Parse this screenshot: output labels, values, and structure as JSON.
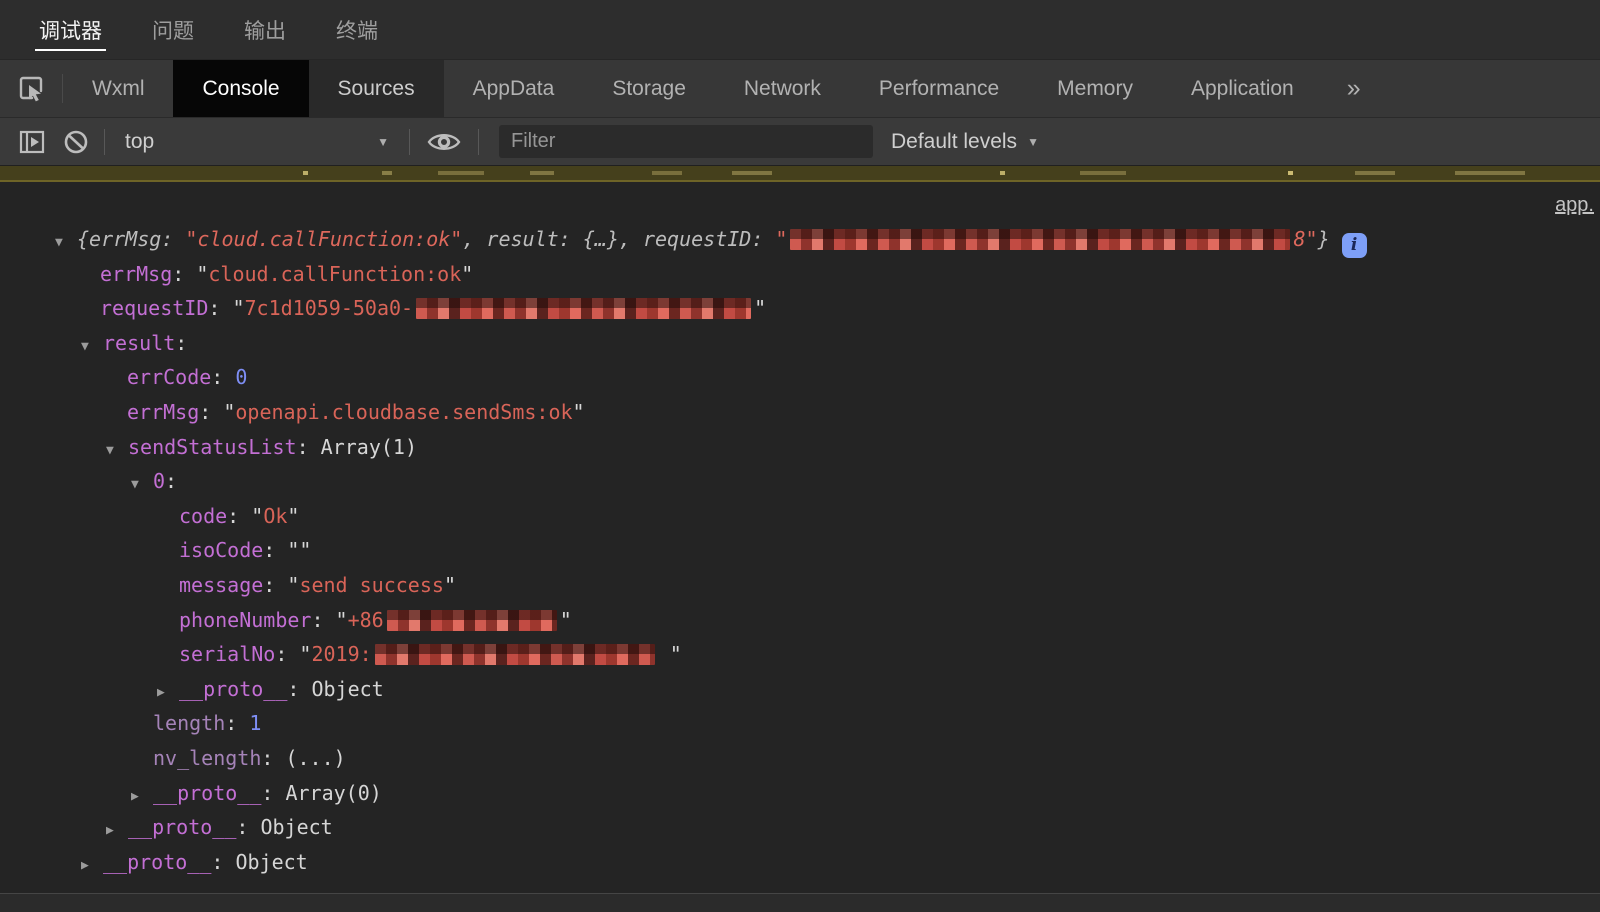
{
  "window": {
    "tabs": [
      {
        "label": "调试器",
        "active": true
      },
      {
        "label": "问题",
        "active": false
      },
      {
        "label": "输出",
        "active": false
      },
      {
        "label": "终端",
        "active": false
      }
    ]
  },
  "devtools": {
    "tabs": [
      {
        "label": "Wxml",
        "state": "normal"
      },
      {
        "label": "Console",
        "state": "active"
      },
      {
        "label": "Sources",
        "state": "highlight"
      },
      {
        "label": "AppData",
        "state": "normal"
      },
      {
        "label": "Storage",
        "state": "normal"
      },
      {
        "label": "Network",
        "state": "normal"
      },
      {
        "label": "Performance",
        "state": "normal"
      },
      {
        "label": "Memory",
        "state": "normal"
      },
      {
        "label": "Application",
        "state": "normal"
      }
    ],
    "overflow_chevron": "»"
  },
  "toolbar": {
    "context_selector": "top",
    "filter_placeholder": "Filter",
    "levels_dropdown": "Default levels",
    "dropdown_arrow": "▼"
  },
  "icons": {
    "inspect": "inspect-element-icon",
    "sidebar_toggle": "show-console-sidebar-icon",
    "clear": "clear-console-icon",
    "eye": "live-expression-icon",
    "info": "i"
  },
  "colors": {
    "property_key": "#c36fd4",
    "property_key_dim": "#a583b8",
    "string_value": "#d96458",
    "number_value": "#7e8ef5",
    "plain_value": "#d6d6d6",
    "preview_text": "#bdbdbd",
    "info_badge_bg": "#7e9ff7",
    "warning_row_bg": "#45401c",
    "console_bg": "#242424"
  },
  "console": {
    "source_link": "app.",
    "rows": [
      {
        "pad": 55,
        "arrow": "down",
        "italic": true,
        "segs": [
          [
            "gi",
            "{errMsg: "
          ],
          [
            "si",
            "\"cloud.callFunction:ok\""
          ],
          [
            "gi",
            ", result: "
          ],
          [
            "gi",
            "{…}"
          ],
          [
            "gi",
            ", requestID: "
          ],
          [
            "si",
            "\""
          ],
          [
            "R",
            500
          ],
          [
            "si",
            "8\""
          ],
          [
            "gi",
            "}"
          ],
          [
            "IC",
            "i"
          ]
        ]
      },
      {
        "pad": 100,
        "arrow": null,
        "segs": [
          [
            "k",
            "errMsg"
          ],
          [
            "p",
            ": "
          ],
          [
            "q",
            "\""
          ],
          [
            "s",
            "cloud.callFunction:ok"
          ],
          [
            "q",
            "\""
          ]
        ]
      },
      {
        "pad": 100,
        "arrow": null,
        "segs": [
          [
            "k",
            "requestID"
          ],
          [
            "p",
            ": "
          ],
          [
            "q",
            "\""
          ],
          [
            "s",
            "7c1d1059-50a0-"
          ],
          [
            "R",
            335
          ],
          [
            "q",
            "\""
          ]
        ]
      },
      {
        "pad": 81,
        "arrow": "down",
        "segs": [
          [
            "k",
            "result"
          ],
          [
            "p",
            ":"
          ]
        ]
      },
      {
        "pad": 127,
        "arrow": null,
        "segs": [
          [
            "k",
            "errCode"
          ],
          [
            "p",
            ": "
          ],
          [
            "n",
            "0"
          ]
        ]
      },
      {
        "pad": 127,
        "arrow": null,
        "segs": [
          [
            "k",
            "errMsg"
          ],
          [
            "p",
            ": "
          ],
          [
            "q",
            "\""
          ],
          [
            "s",
            "openapi.cloudbase.sendSms:ok"
          ],
          [
            "q",
            "\""
          ]
        ]
      },
      {
        "pad": 106,
        "arrow": "down",
        "segs": [
          [
            "k",
            "sendStatusList"
          ],
          [
            "p",
            ": "
          ],
          [
            "p",
            "Array(1)"
          ]
        ]
      },
      {
        "pad": 131,
        "arrow": "down",
        "segs": [
          [
            "k",
            "0"
          ],
          [
            "p",
            ":"
          ]
        ]
      },
      {
        "pad": 179,
        "arrow": null,
        "segs": [
          [
            "k",
            "code"
          ],
          [
            "p",
            ": "
          ],
          [
            "q",
            "\""
          ],
          [
            "s",
            "Ok"
          ],
          [
            "q",
            "\""
          ]
        ]
      },
      {
        "pad": 179,
        "arrow": null,
        "segs": [
          [
            "k",
            "isoCode"
          ],
          [
            "p",
            ": "
          ],
          [
            "q",
            "\"\""
          ]
        ]
      },
      {
        "pad": 179,
        "arrow": null,
        "segs": [
          [
            "k",
            "message"
          ],
          [
            "p",
            ": "
          ],
          [
            "q",
            "\""
          ],
          [
            "s",
            "send success"
          ],
          [
            "q",
            "\""
          ]
        ]
      },
      {
        "pad": 179,
        "arrow": null,
        "segs": [
          [
            "k",
            "phoneNumber"
          ],
          [
            "p",
            ": "
          ],
          [
            "q",
            "\""
          ],
          [
            "s",
            "+86"
          ],
          [
            "R",
            170
          ],
          [
            "q",
            "\""
          ]
        ]
      },
      {
        "pad": 179,
        "arrow": null,
        "segs": [
          [
            "k",
            "serialNo"
          ],
          [
            "p",
            ": "
          ],
          [
            "q",
            "\""
          ],
          [
            "s",
            "2019:"
          ],
          [
            "R",
            280
          ],
          [
            "p",
            " "
          ],
          [
            "q",
            "\""
          ]
        ]
      },
      {
        "pad": 157,
        "arrow": "right",
        "segs": [
          [
            "k",
            "__proto__"
          ],
          [
            "p",
            ": "
          ],
          [
            "p",
            "Object"
          ]
        ]
      },
      {
        "pad": 153,
        "arrow": null,
        "segs": [
          [
            "kd",
            "length"
          ],
          [
            "p",
            ": "
          ],
          [
            "n",
            "1"
          ]
        ]
      },
      {
        "pad": 153,
        "arrow": null,
        "segs": [
          [
            "kd",
            "nv_length"
          ],
          [
            "p",
            ": "
          ],
          [
            "p",
            "(...)"
          ]
        ]
      },
      {
        "pad": 131,
        "arrow": "right",
        "segs": [
          [
            "k",
            "__proto__"
          ],
          [
            "p",
            ": "
          ],
          [
            "p",
            "Array(0)"
          ]
        ]
      },
      {
        "pad": 106,
        "arrow": "right",
        "segs": [
          [
            "k",
            "__proto__"
          ],
          [
            "p",
            ": "
          ],
          [
            "p",
            "Object"
          ]
        ]
      },
      {
        "pad": 81,
        "arrow": "right",
        "segs": [
          [
            "k",
            "__proto__"
          ],
          [
            "p",
            ": "
          ],
          [
            "p",
            "Object"
          ]
        ]
      }
    ]
  }
}
